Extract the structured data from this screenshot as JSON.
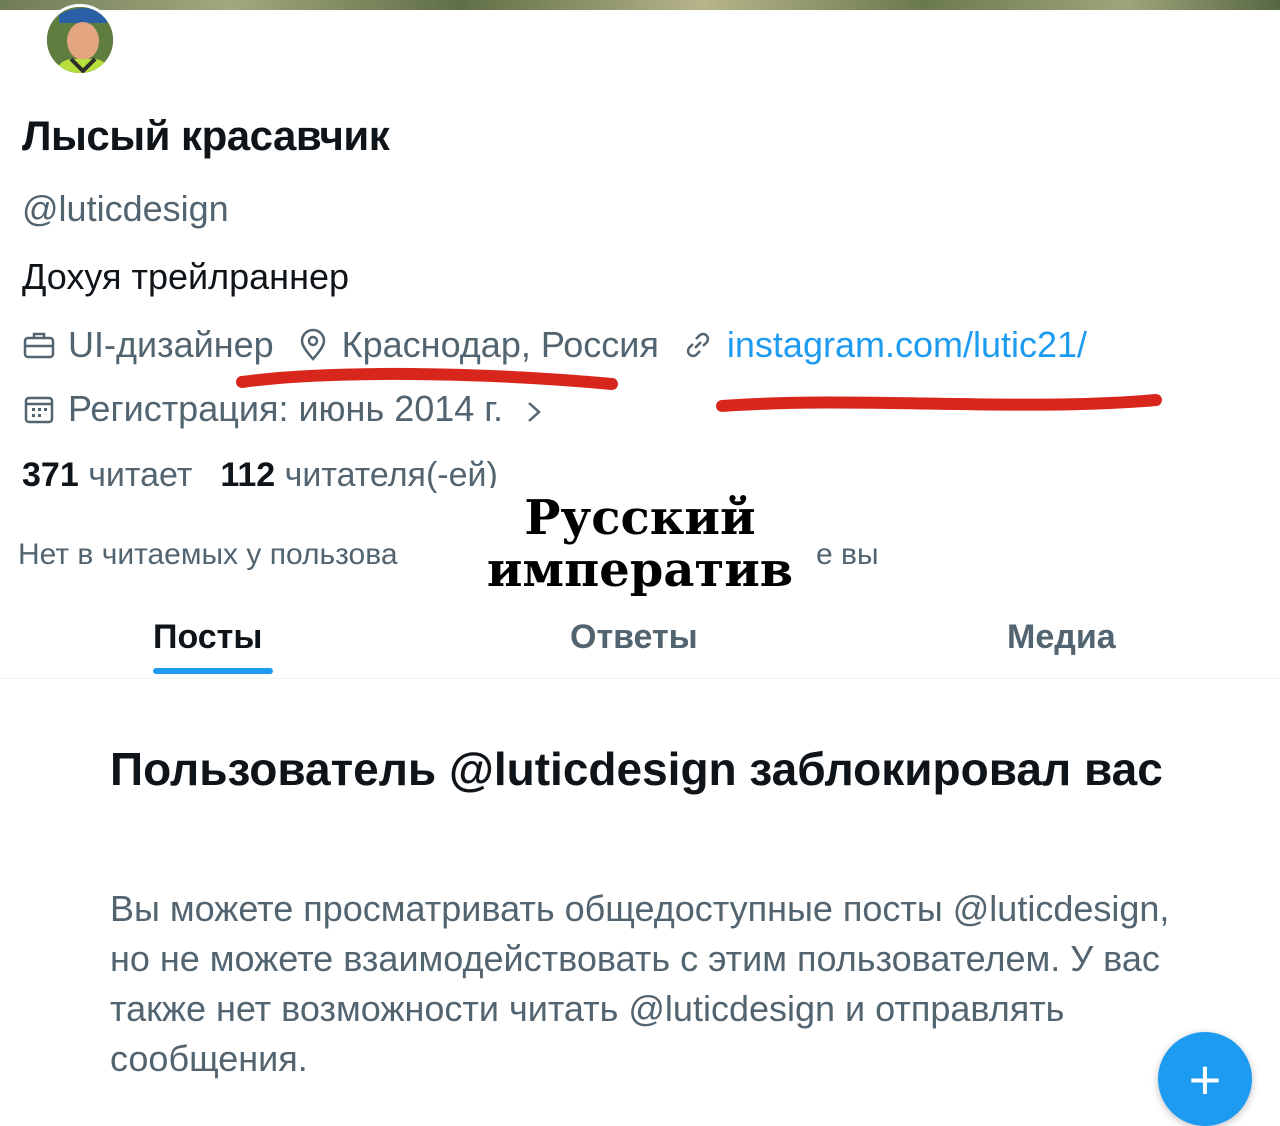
{
  "profile": {
    "display_name": "Лысый красавчик",
    "handle": "@luticdesign",
    "bio": "Дохуя трейлраннер",
    "profession": "UI-дизайнер",
    "location": "Краснодар, Россия",
    "website": "instagram.com/lutic21/",
    "joined": "Регистрация: июнь 2014 г.",
    "following_count": "371",
    "following_label": "читает",
    "followers_count": "112",
    "followers_label": "читателя(-ей)"
  },
  "notice": {
    "visible_start": "Нет в читаемых у пользова",
    "visible_end": "е вы"
  },
  "overlay": {
    "line1": "Русский",
    "line2": "императив"
  },
  "tabs": [
    {
      "label": "Посты",
      "active": true
    },
    {
      "label": "Ответы",
      "active": false
    },
    {
      "label": "Медиа",
      "active": false
    }
  ],
  "blocked": {
    "title": "Пользователь @luticdesign заблокировал вас",
    "description": "Вы можете просматривать общедоступные посты @luticdesign, но не можете взаимодействовать с этим пользователем. У вас также нет возможности читать @luticdesign и отправлять сообщения."
  },
  "fab": {
    "label": "+"
  },
  "colors": {
    "accent": "#1d9bf0",
    "secondary_text": "#536471",
    "annotation_red": "#d8261c"
  }
}
